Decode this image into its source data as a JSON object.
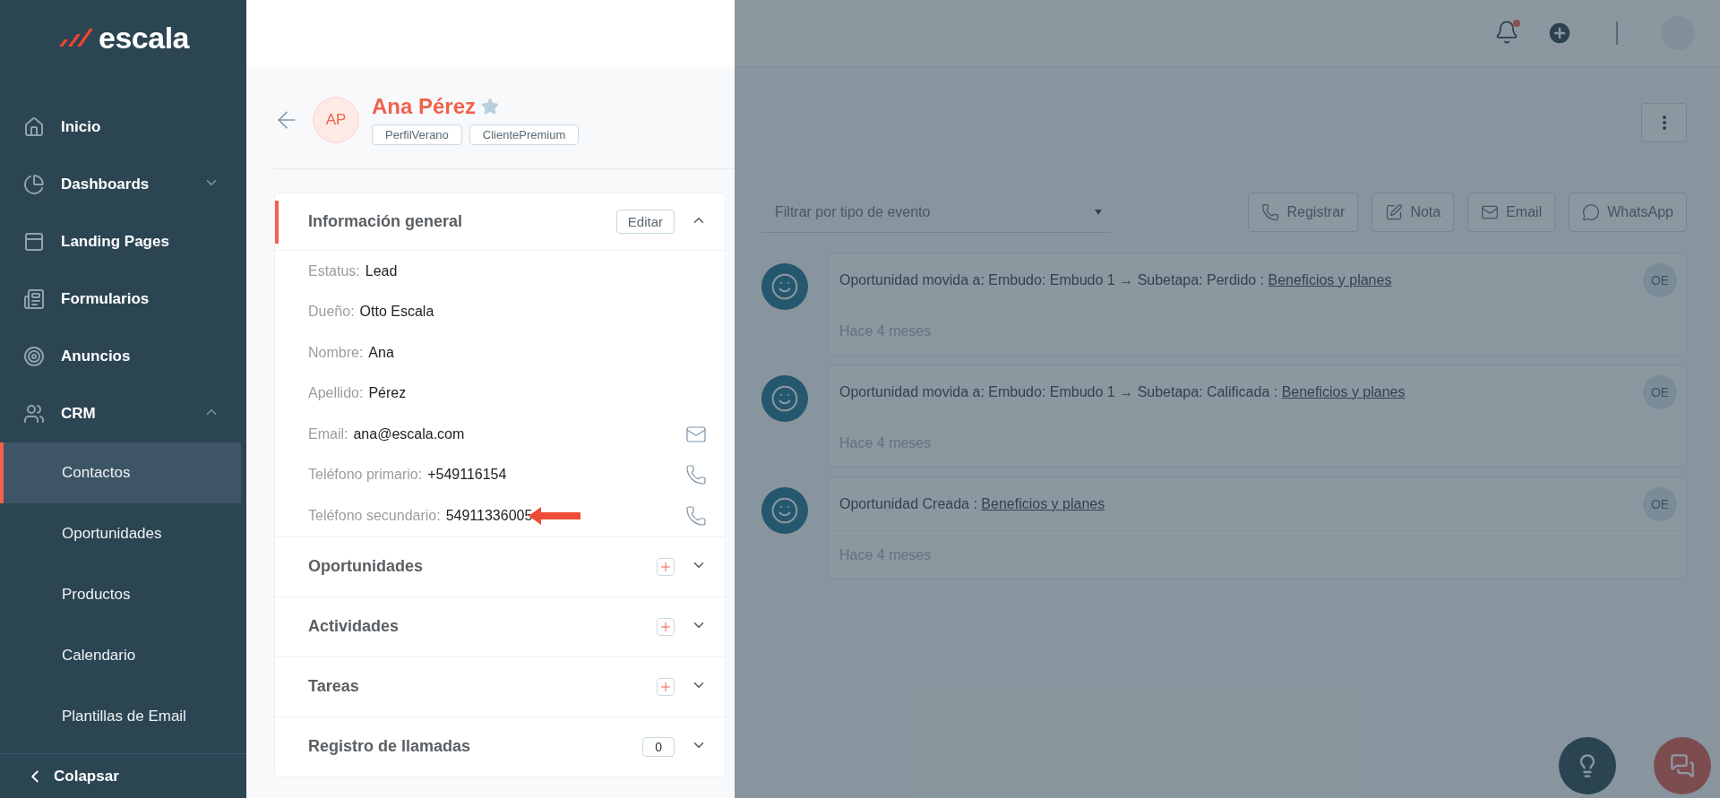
{
  "sidebar": {
    "logo": "escala",
    "items": [
      {
        "label": "Inicio",
        "selected": false
      },
      {
        "label": "Dashboards",
        "selected": false,
        "expanded": false
      },
      {
        "label": "Landing Pages",
        "selected": false
      },
      {
        "label": "Formularios",
        "selected": false
      },
      {
        "label": "Anuncios",
        "selected": false
      },
      {
        "label": "CRM",
        "selected": false,
        "expanded": true,
        "children": [
          {
            "label": "Contactos",
            "selected": true
          },
          {
            "label": "Oportunidades",
            "selected": false
          },
          {
            "label": "Productos",
            "selected": false
          },
          {
            "label": "Calendario",
            "selected": false
          },
          {
            "label": "Plantillas de Email",
            "selected": false
          }
        ]
      }
    ],
    "collapse_label": "Colapsar"
  },
  "header": {
    "has_unread_notifications": true
  },
  "contact": {
    "initials": "AP",
    "name": "Ana Pérez",
    "starred": false,
    "tags": [
      "PerfilVerano",
      "ClientePremium"
    ],
    "info": {
      "title": "Información general",
      "edit_label": "Editar",
      "expanded": true,
      "fields": [
        {
          "label": "Estatus:",
          "value": "Lead",
          "kind": "text"
        },
        {
          "label": "Dueño:",
          "value": "Otto Escala",
          "kind": "text"
        },
        {
          "label": "Nombre:",
          "value": "Ana",
          "kind": "text"
        },
        {
          "label": "Apellido:",
          "value": "Pérez",
          "kind": "text"
        },
        {
          "label": "Email:",
          "value": "ana@escala.com",
          "kind": "email"
        },
        {
          "label": "Teléfono primario:",
          "value": "+549116154",
          "kind": "phone"
        },
        {
          "label": "Teléfono secundario:",
          "value": "54911336005",
          "kind": "phone",
          "annotated": true
        }
      ]
    },
    "sections": [
      {
        "title": "Oportunidades",
        "kind": "add",
        "expanded": false
      },
      {
        "title": "Actividades",
        "kind": "add",
        "expanded": false
      },
      {
        "title": "Tareas",
        "kind": "add",
        "expanded": false
      },
      {
        "title": "Registro de llamadas",
        "kind": "count",
        "count": "0",
        "expanded": false
      }
    ]
  },
  "timeline": {
    "filter_placeholder": "Filtrar por tipo de evento",
    "actions": [
      {
        "label": "Registrar",
        "kind": "phone"
      },
      {
        "label": "Nota",
        "kind": "note"
      },
      {
        "label": "Email",
        "kind": "email"
      },
      {
        "label": "WhatsApp",
        "kind": "whatsapp"
      }
    ],
    "events": [
      {
        "text": "Oportunidad movida a: Embudo: Embudo 1 → Subetapa: Perdido :",
        "link": "Beneficios y planes",
        "time": "Hace 4 meses",
        "user": "OE"
      },
      {
        "text": "Oportunidad movida a: Embudo: Embudo 1 → Subetapa: Calificada :",
        "link": "Beneficios y planes",
        "time": "Hace 4 meses",
        "user": "OE"
      },
      {
        "text": "Oportunidad Creada :",
        "link": "Beneficios y planes",
        "time": "Hace 4 meses",
        "user": "OE"
      }
    ]
  }
}
